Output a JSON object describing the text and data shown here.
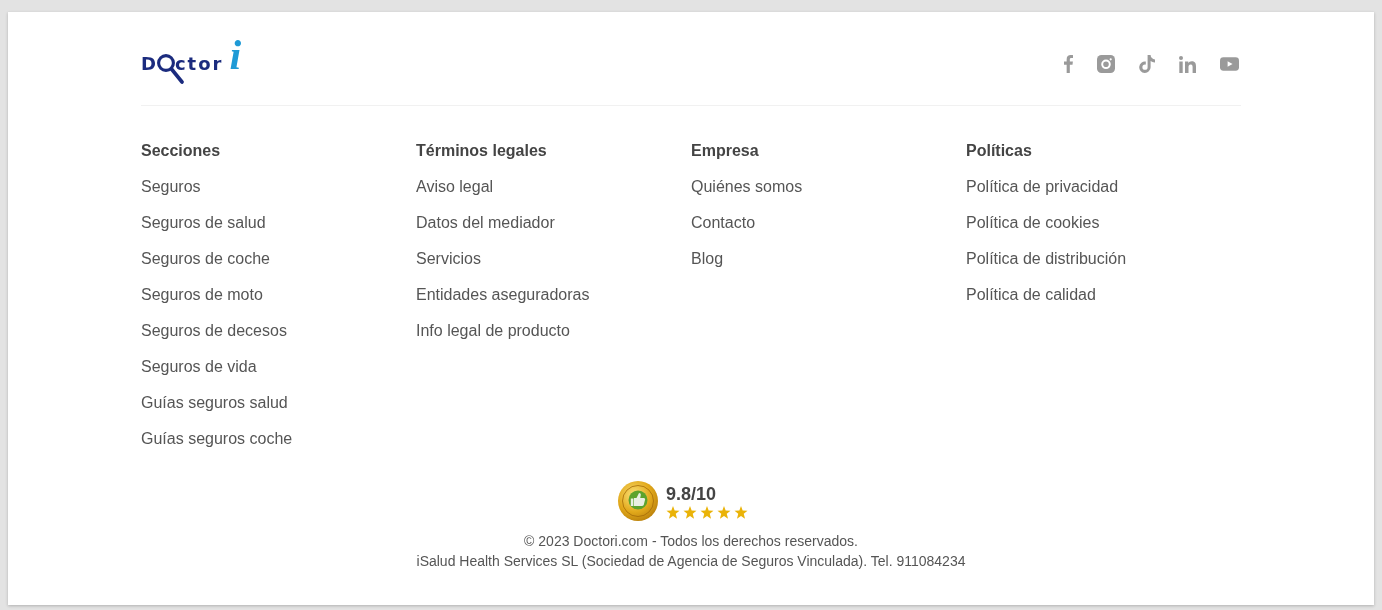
{
  "logo": {
    "initial": "D",
    "wordmark": "ctor",
    "mark": "i"
  },
  "social_links": [
    {
      "kind": "facebook"
    },
    {
      "kind": "instagram"
    },
    {
      "kind": "tiktok"
    },
    {
      "kind": "linkedin"
    },
    {
      "kind": "youtube"
    }
  ],
  "columns": [
    {
      "heading": "Secciones",
      "links": [
        "Seguros",
        "Seguros de salud",
        "Seguros de coche",
        "Seguros de moto",
        "Seguros de decesos",
        "Seguros de vida",
        "Guías seguros salud",
        "Guías seguros coche"
      ]
    },
    {
      "heading": "Términos legales",
      "links": [
        "Aviso legal",
        "Datos del mediador",
        "Servicios",
        "Entidades aseguradoras",
        "Info legal de producto"
      ]
    },
    {
      "heading": "Empresa",
      "links": [
        "Quiénes somos",
        "Contacto",
        "Blog"
      ]
    },
    {
      "heading": "Políticas",
      "links": [
        "Política de privacidad",
        "Política de cookies",
        "Política de distribución",
        "Política de calidad"
      ]
    }
  ],
  "rating": {
    "score": "9.8/10",
    "stars": 5
  },
  "footer": {
    "lines": [
      "© 2023 Doctori.com - Todos los derechos reservados.",
      "iSalud Health Services SL (Sociedad de Agencia de Seguros Vinculada). Tel. 911084234"
    ]
  }
}
